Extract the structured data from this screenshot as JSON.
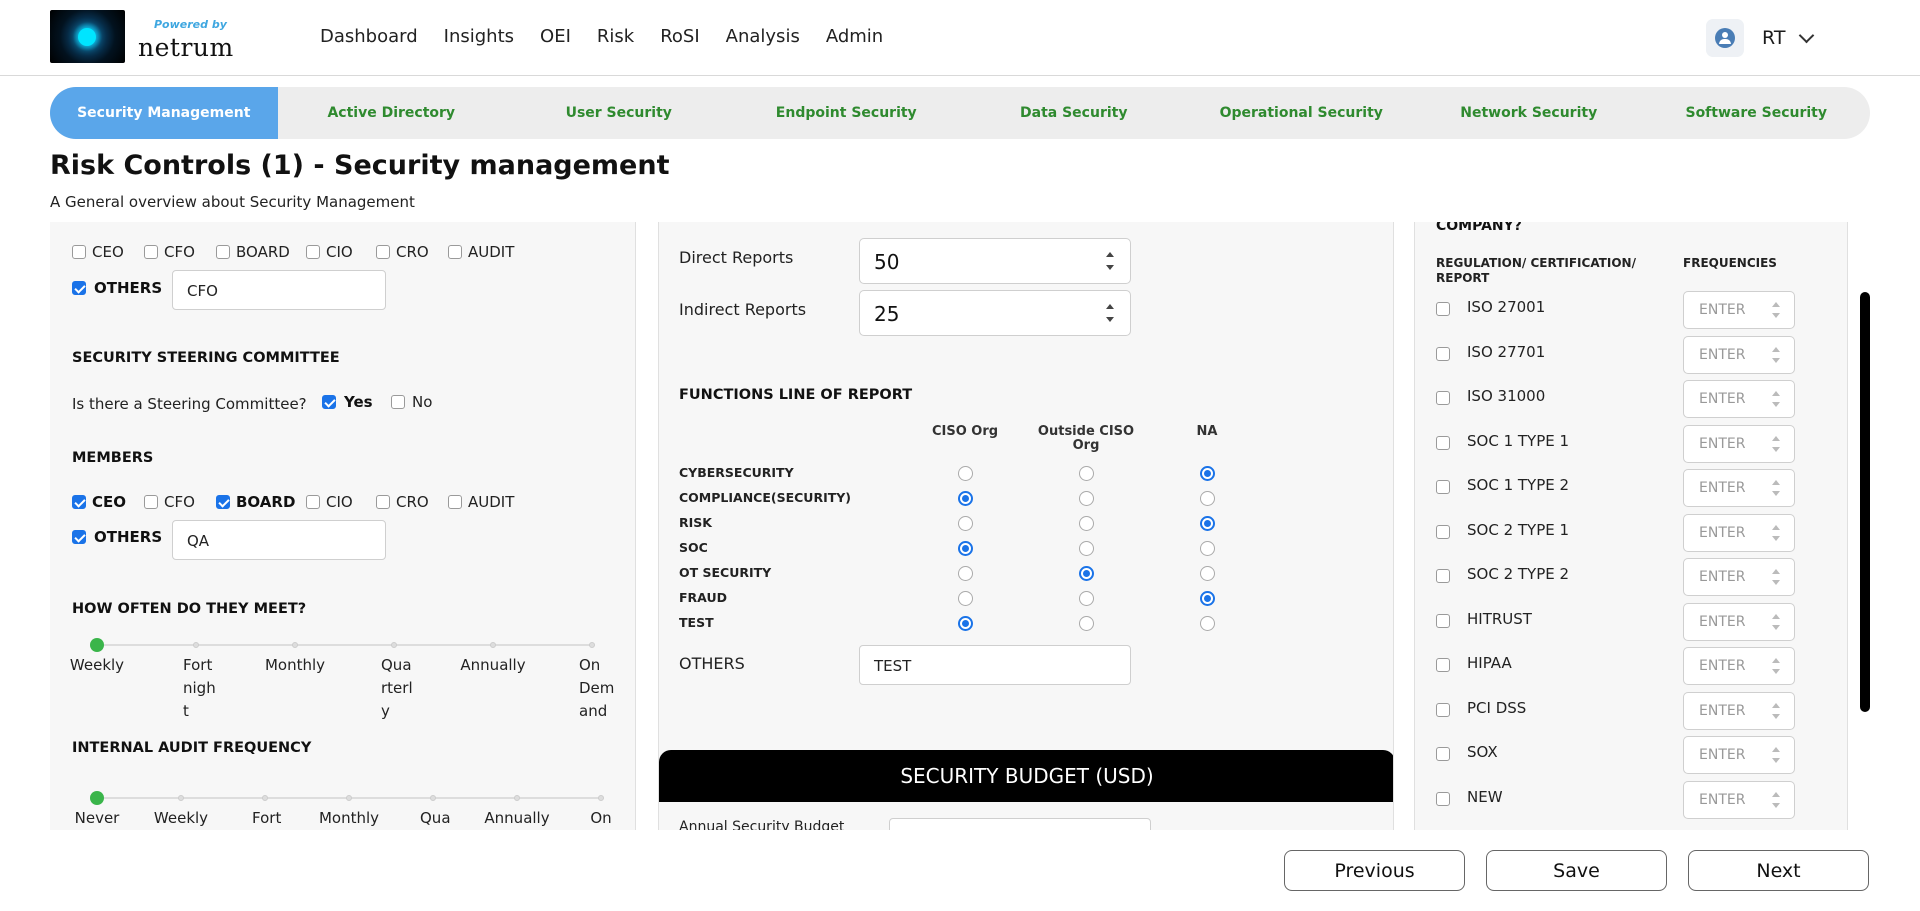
{
  "brand": {
    "powered": "Powered by",
    "name": "netrum"
  },
  "nav": [
    "Dashboard",
    "Insights",
    "OEI",
    "Risk",
    "RoSI",
    "Analysis",
    "Admin"
  ],
  "user": {
    "initials": "RT"
  },
  "tabs": [
    "Security Management",
    "Active Directory",
    "User Security",
    "Endpoint Security",
    "Data Security",
    "Operational Security",
    "Network Security",
    "Software Security"
  ],
  "page": {
    "title": "Risk Controls (1) - Security management",
    "subtitle": "A General overview about Security Management"
  },
  "left": {
    "reports_to": {
      "options": [
        "CEO",
        "CFO",
        "BOARD",
        "CIO",
        "CRO",
        "AUDIT"
      ],
      "checked": [
        false,
        false,
        false,
        false,
        false,
        false
      ],
      "others_label": "OTHERS",
      "others_checked": true,
      "others_value": "CFO"
    },
    "steering": {
      "heading": "SECURITY STEERING COMMITTEE",
      "question": "Is there a Steering Committee?",
      "yes": "Yes",
      "no": "No",
      "yes_checked": true,
      "no_checked": false
    },
    "members": {
      "heading": "MEMBERS",
      "options": [
        "CEO",
        "CFO",
        "BOARD",
        "CIO",
        "CRO",
        "AUDIT"
      ],
      "checked": [
        true,
        false,
        true,
        false,
        false,
        false
      ],
      "others_label": "OTHERS",
      "others_checked": true,
      "others_value": "QA"
    },
    "meet": {
      "heading": "HOW OFTEN DO THEY MEET?",
      "stops": [
        "Weekly",
        "Fortnight",
        "Monthly",
        "Quarterly",
        "Annually",
        "On Demand"
      ],
      "selected": "Weekly"
    },
    "audit": {
      "heading": "INTERNAL AUDIT FREQUENCY",
      "stops": [
        "Never",
        "Weekly",
        "Fortnight",
        "Monthly",
        "Quarterly",
        "Annually",
        "On"
      ],
      "selected": "Never"
    }
  },
  "middle": {
    "direct_label": "Direct Reports",
    "direct_value": "50",
    "indirect_label": "Indirect Reports",
    "indirect_value": "25",
    "functions_heading": "FUNCTIONS LINE OF REPORT",
    "columns": [
      "CISO Org",
      "Outside CISO Org",
      "NA"
    ],
    "rows": [
      {
        "label": "CYBERSECURITY",
        "selected": 2
      },
      {
        "label": "COMPLIANCE(SECURITY)",
        "selected": 0
      },
      {
        "label": "RISK",
        "selected": 2
      },
      {
        "label": "SOC",
        "selected": 0
      },
      {
        "label": "OT SECURITY",
        "selected": 1
      },
      {
        "label": "FRAUD",
        "selected": 2
      },
      {
        "label": "TEST",
        "selected": 0
      }
    ],
    "others_label": "OTHERS",
    "others_value": "TEST",
    "budget_heading": "SECURITY BUDGET (USD)",
    "annual_budget_label": "Annual Security Budget"
  },
  "right": {
    "company_heading": "COMPANY?",
    "col_regulation": "REGULATION/ CERTIFICATION/ REPORT",
    "col_frequencies": "FREQUENCIES",
    "items": [
      "ISO 27001",
      "ISO 27701",
      "ISO 31000",
      "SOC 1 TYPE 1",
      "SOC 1 TYPE 2",
      "SOC 2 TYPE 1",
      "SOC 2 TYPE 2",
      "HITRUST",
      "HIPAA",
      "PCI DSS",
      "SOX",
      "NEW"
    ],
    "placeholder": "ENTER"
  },
  "footer": {
    "previous": "Previous",
    "save": "Save",
    "next": "Next"
  },
  "colors": {
    "accent": "#1a73e8",
    "tab_active": "#5aa6ea",
    "tab_text": "#2f8a2f",
    "slider_knob": "#3ab54a"
  }
}
